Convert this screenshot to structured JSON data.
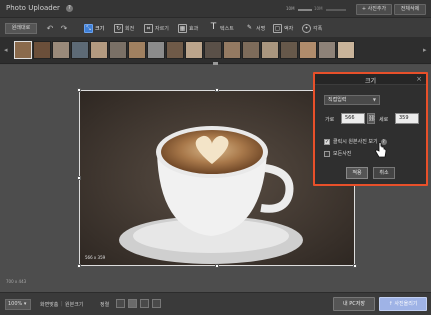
{
  "app": {
    "title": "Photo Uploader",
    "help": "?"
  },
  "top": {
    "zoom_min": "10M",
    "zoom_max": "10M",
    "add_photo": "+ 사진추가",
    "delete_all": "전체삭제"
  },
  "toolbar": {
    "restore": "원래대로",
    "undo_icon": "undo-icon",
    "redo_icon": "redo-icon",
    "tools": [
      {
        "label": "크기",
        "icon": "resize-icon",
        "active": true
      },
      {
        "label": "회전",
        "icon": "rotate-icon",
        "active": false
      },
      {
        "label": "자르기",
        "icon": "crop-icon",
        "active": false
      },
      {
        "label": "효과",
        "icon": "effect-icon",
        "active": false
      },
      {
        "label": "텍스트",
        "icon": "text-icon",
        "active": false
      },
      {
        "label": "서명",
        "icon": "signature-icon",
        "active": false
      },
      {
        "label": "액자",
        "icon": "frame-icon",
        "active": false
      },
      {
        "label": "각폭",
        "icon": "sticker-icon",
        "active": false
      }
    ]
  },
  "thumbnails": {
    "count": 18,
    "selected_index": 0,
    "colors": [
      "#8a6a4c",
      "#6b4f3a",
      "#9a8a7a",
      "#5d6a76",
      "#b39a80",
      "#7a7066",
      "#a08060",
      "#8c8c8c",
      "#6f5a48",
      "#bca58c",
      "#5a5048",
      "#947a62",
      "#7d6b5a",
      "#a9967f",
      "#66584a",
      "#b08c6c",
      "#8e8278",
      "#c9b49a"
    ]
  },
  "canvas": {
    "selection_size": "566 x 359",
    "original_size": "700 x 443"
  },
  "dialog": {
    "title": "크기",
    "close": "×",
    "mode_select": "직접입력",
    "width_label": "가로",
    "width_value": "566",
    "height_label": "세로",
    "height_value": "359",
    "option_view_original": "클릭시 원본사진 보기",
    "option_view_original_checked": true,
    "option_all_photos": "모든사진",
    "option_all_photos_checked": false,
    "help": "?",
    "apply": "적용",
    "cancel": "취소"
  },
  "bottom": {
    "zoom": "100%",
    "fit_screen": "화면맞춤",
    "original_size": "원본크기",
    "sort_label": "정렬",
    "save_pc": "내 PC저장",
    "upload": "↑ 사진올리기"
  },
  "colors": {
    "accent_dialog_border": "#e8502a",
    "active_tool": "#3f7fd6",
    "upload_button": "#9fb3e6"
  }
}
